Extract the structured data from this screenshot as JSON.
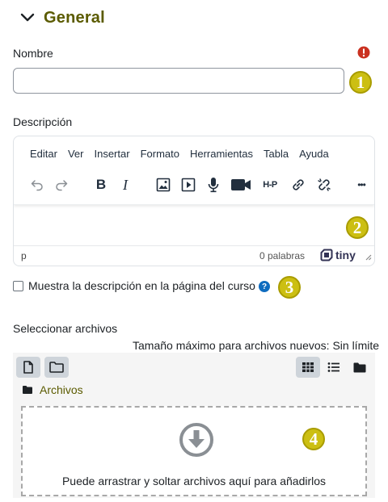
{
  "section": {
    "title": "General"
  },
  "name_field": {
    "label": "Nombre",
    "value": "",
    "required_icon": "exclamation-circle-icon"
  },
  "description": {
    "label": "Descripción",
    "menu": [
      "Editar",
      "Ver",
      "Insertar",
      "Formato",
      "Herramientas",
      "Tabla",
      "Ayuda"
    ],
    "toolbar_icons": [
      "undo-icon",
      "redo-icon",
      "bold-icon",
      "italic-icon",
      "image-icon",
      "media-icon",
      "record-audio-icon",
      "record-video-icon",
      "h5p-icon",
      "link-icon",
      "unlink-icon",
      "more-icon"
    ],
    "toolbar_text": {
      "bold": "B",
      "italic": "I",
      "h5p": "H-P",
      "more": "•••"
    },
    "status_path": "p",
    "word_count": "0 palabras",
    "brand": "tiny"
  },
  "show_description": {
    "label": "Muestra la descripción en la página del curso",
    "checked": false
  },
  "files": {
    "label": "Seleccionar archivos",
    "max_size": "Tamaño máximo para archivos nuevos: Sin límite",
    "breadcrumb": "Archivos",
    "drop_text": "Puede arrastrar y soltar archivos aquí para añadirlos"
  },
  "badges": [
    "1",
    "2",
    "3",
    "4"
  ],
  "colors": {
    "accent": "#5b5b00",
    "badge": "#ccbf12",
    "help": "#0f6cbf",
    "required": "#ca3120"
  }
}
